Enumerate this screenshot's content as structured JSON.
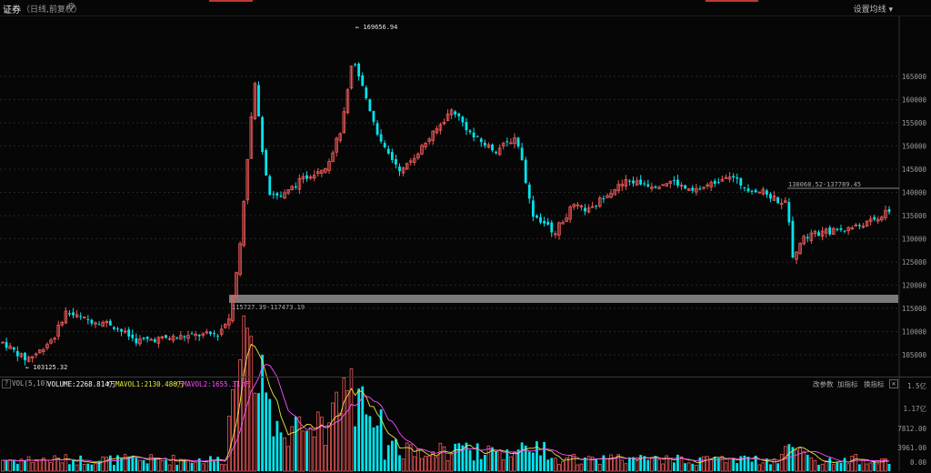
{
  "header": {
    "title": "证券",
    "subtitle": "（日线,前复权）",
    "settings_icon": "gear-icon",
    "ma_setting_label": "设置均线",
    "ma_setting_icon": "chevron-down-icon"
  },
  "main_chart": {
    "y_ticks": [
      "165000",
      "160000",
      "155000",
      "150000",
      "145000",
      "140000",
      "135000",
      "130000",
      "125000",
      "120000",
      "115000",
      "110000",
      "105000"
    ],
    "high_label": "169656.94",
    "low_label": "103125.32",
    "zone_upper_label": "138068.52-137789.45",
    "zone_lower_label": "115727.39-117473.19",
    "colors": {
      "up": "#f05a5a",
      "down": "#00e5ee",
      "zone": "#7a7a7a"
    }
  },
  "volume_panel": {
    "help_label": "?",
    "indicator_label": "VOL(5,10)",
    "volume_text": "VOLUME:2268.814万",
    "mavol1_text": "MAVOL1:2130.486万",
    "mavol2_text": "MAVOL2:1655.311万",
    "arrow_glyph": "↑",
    "buttons": [
      "改参数",
      "加指标",
      "换指标"
    ],
    "close_glyph": "✕",
    "y_ticks": [
      "1.5亿",
      "1.17亿",
      "7812.00",
      "3961.00",
      "0.00"
    ],
    "colors": {
      "volume": "#ffffff",
      "mavol1": "#e8e83c",
      "mavol2": "#ff4dff"
    }
  }
}
